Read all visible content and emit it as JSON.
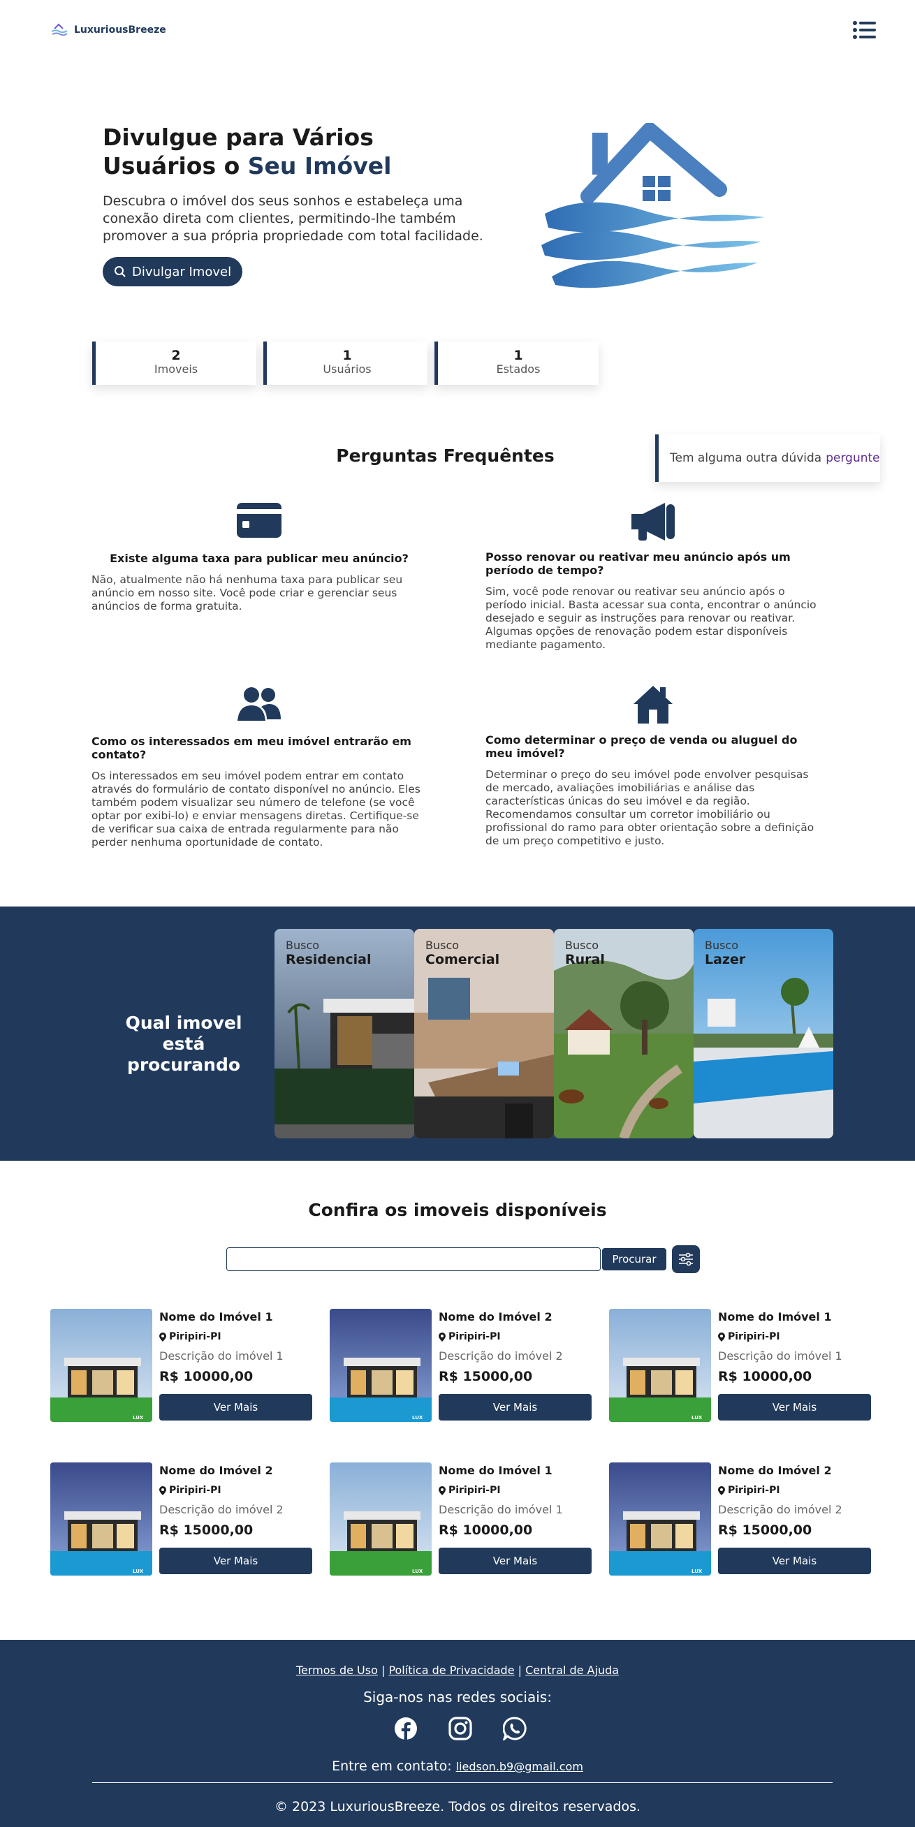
{
  "header": {
    "logo_text": "LuxuriousBreeze"
  },
  "hero": {
    "title_line1": "Divulgue para Vários",
    "title_line2_a": "Usuários o ",
    "title_line2_b": "Seu Imóvel",
    "description": "Descubra o imóvel dos seus sonhos e estabeleça uma conexão direta com clientes, permitindo-lhe também promover a sua própria propriedade com total facilidade.",
    "button_label": "Divulgar Imovel"
  },
  "stats": [
    {
      "value": "2",
      "label": "Imoveis"
    },
    {
      "value": "1",
      "label": "Usuários"
    },
    {
      "value": "1",
      "label": "Estados"
    }
  ],
  "faq": {
    "title": "Perguntas Frequêntes",
    "ask_text": "Tem alguma outra dúvida",
    "ask_link": "pergunte",
    "items": [
      {
        "icon": "credit-card-icon",
        "question": "Existe alguma taxa para publicar meu anúncio?",
        "answer": "Não, atualmente não há nenhuma taxa para publicar seu anúncio em nosso site. Você pode criar e gerenciar seus anúncios de forma gratuita."
      },
      {
        "icon": "megaphone-icon",
        "question": "Posso renovar ou reativar meu anúncio após um período de tempo?",
        "answer": "Sim, você pode renovar ou reativar seu anúncio após o período inicial. Basta acessar sua conta, encontrar o anúncio desejado e seguir as instruções para renovar ou reativar. Algumas opções de renovação podem estar disponíveis mediante pagamento."
      },
      {
        "icon": "users-icon",
        "question": "Como os interessados em meu imóvel entrarão em contato?",
        "answer": "Os interessados em seu imóvel podem entrar em contato através do formulário de contato disponível no anúncio. Eles também podem visualizar seu número de telefone (se você optar por exibi-lo) e enviar mensagens diretas. Certifique-se de verificar sua caixa de entrada regularmente para não perder nenhuma oportunidade de contato."
      },
      {
        "icon": "house-icon",
        "question": "Como determinar o preço de venda ou aluguel do meu imóvel?",
        "answer": "Determinar o preço do seu imóvel pode envolver pesquisas de mercado, avaliações imobiliárias e análise das características únicas do seu imóvel e da região. Recomendamos consultar um corretor imobiliário ou profissional do ramo para obter orientação sobre a definição de um preço competitivo e justo."
      }
    ]
  },
  "banner": {
    "title": "Qual imovel está procurando",
    "categories": [
      {
        "prefix": "Busco",
        "name": "Residencial"
      },
      {
        "prefix": "Busco",
        "name": "Comercial"
      },
      {
        "prefix": "Busco",
        "name": "Rural"
      },
      {
        "prefix": "Busco",
        "name": "Lazer"
      }
    ]
  },
  "listings": {
    "title": "Confira os imoveis disponíveis",
    "search_value": "",
    "search_button": "Procurar",
    "cards": [
      {
        "name": "Nome do Imóvel 1",
        "location": "Piripiri-PI",
        "description": "Descrição do imóvel 1",
        "price": "R$ 10000,00",
        "button": "Ver Mais"
      },
      {
        "name": "Nome do Imóvel 2",
        "location": "Piripiri-PI",
        "description": "Descrição do imóvel 2",
        "price": "R$ 15000,00",
        "button": "Ver Mais"
      },
      {
        "name": "Nome do Imóvel 1",
        "location": "Piripiri-PI",
        "description": "Descrição do imóvel 1",
        "price": "R$ 10000,00",
        "button": "Ver Mais"
      },
      {
        "name": "Nome do Imóvel 2",
        "location": "Piripiri-PI",
        "description": "Descrição do imóvel 2",
        "price": "R$ 15000,00",
        "button": "Ver Mais"
      },
      {
        "name": "Nome do Imóvel 1",
        "location": "Piripiri-PI",
        "description": "Descrição do imóvel 1",
        "price": "R$ 10000,00",
        "button": "Ver Mais"
      },
      {
        "name": "Nome do Imóvel 2",
        "location": "Piripiri-PI",
        "description": "Descrição do imóvel 2",
        "price": "R$ 15000,00",
        "button": "Ver Mais"
      }
    ]
  },
  "footer": {
    "links": [
      "Termos de Uso",
      "Política de Privacidade",
      "Central de Ajuda"
    ],
    "social_title": "Siga-nos nas redes sociais:",
    "social_icons": [
      "facebook-icon",
      "instagram-icon",
      "whatsapp-icon"
    ],
    "contact_label": "Entre em contato:",
    "contact_email": "liedson.b9@gmail.com",
    "copyright": "© 2023 LuxuriousBreeze. Todos os direitos reservados."
  },
  "colors": {
    "primary": "#213a5c",
    "accent_light": "#6fb3de",
    "link": "#5c2d91"
  }
}
